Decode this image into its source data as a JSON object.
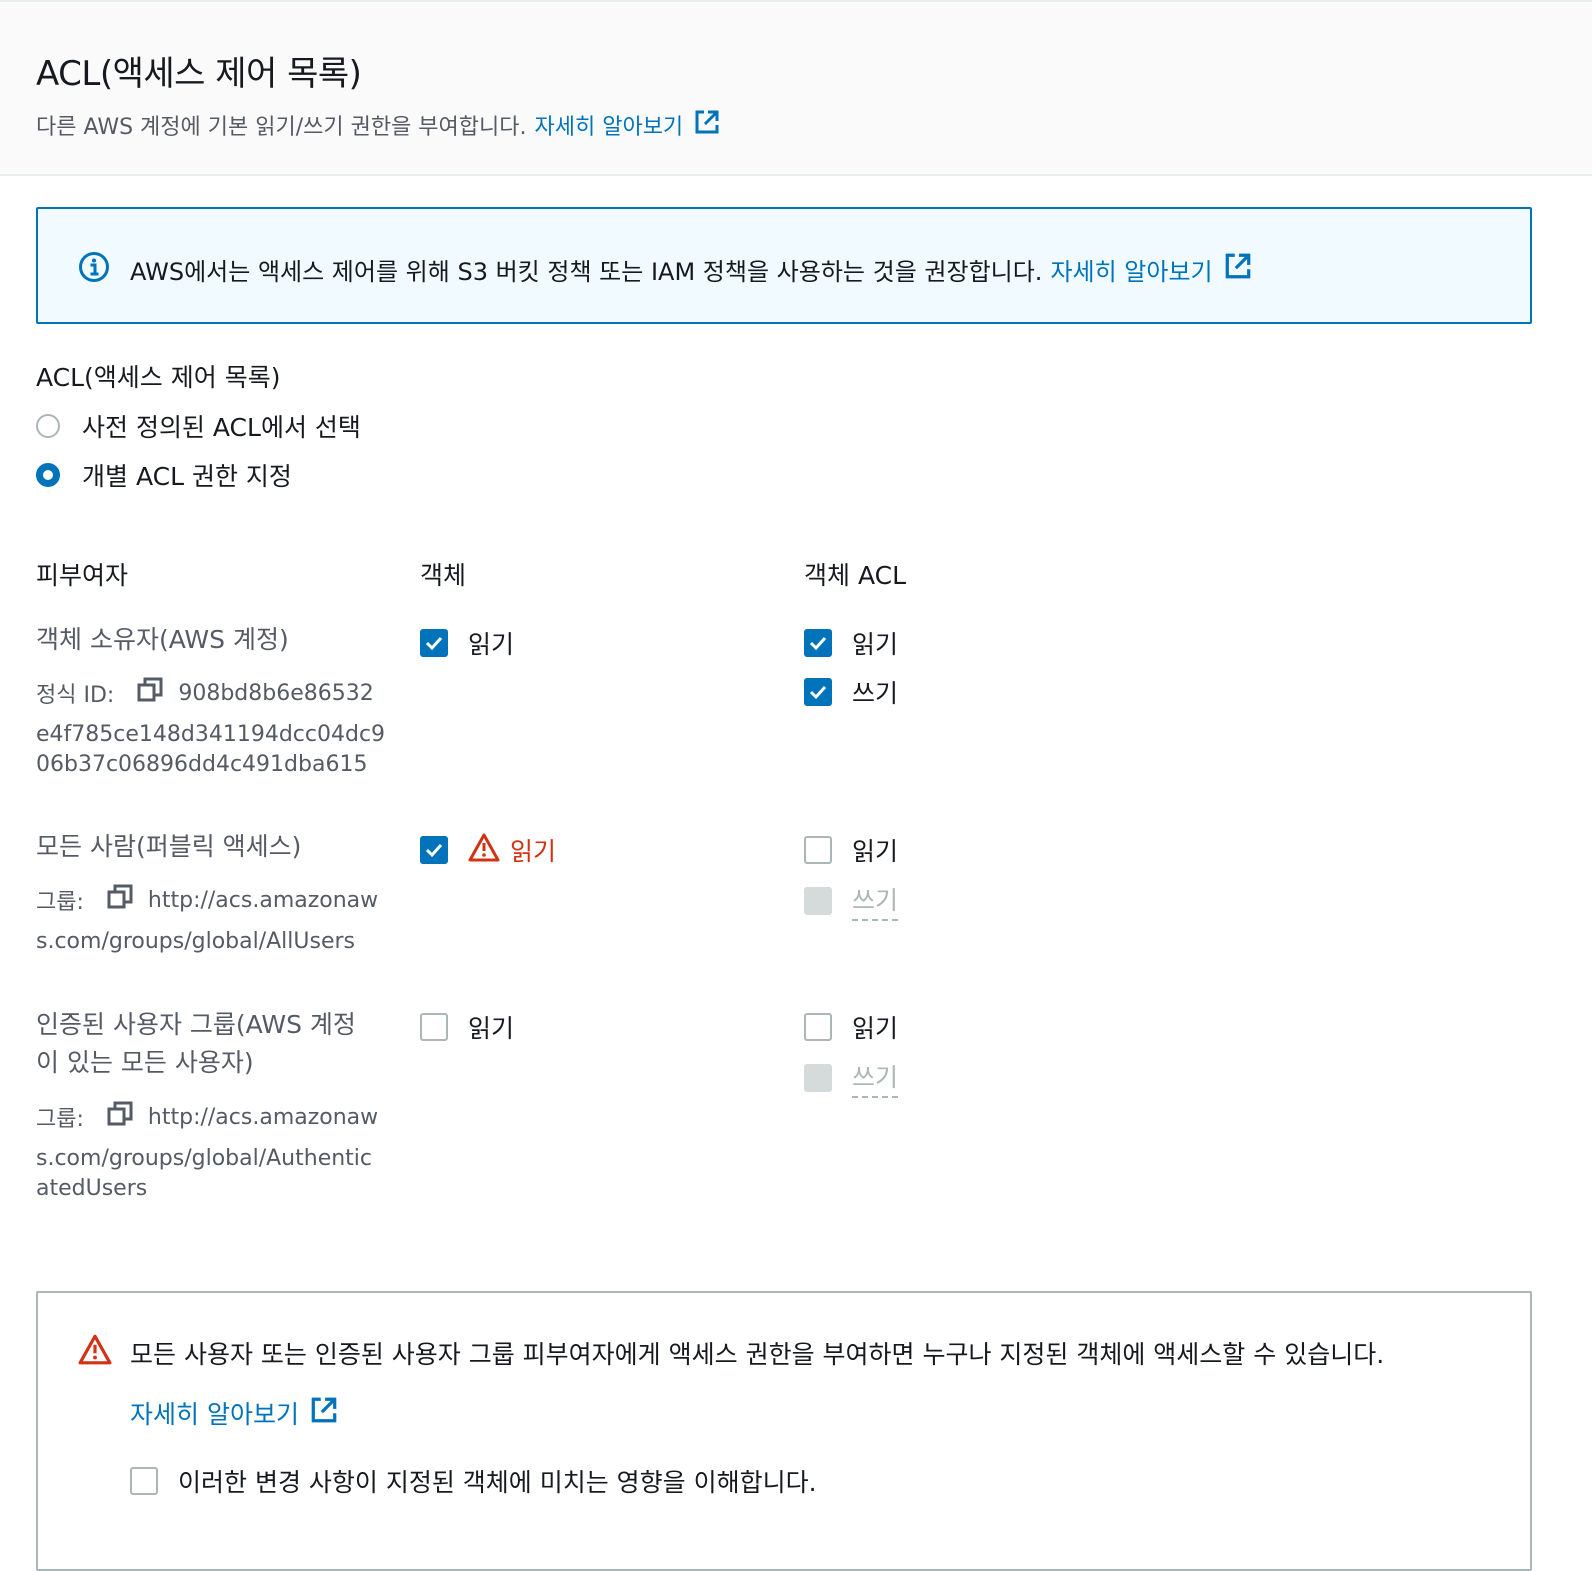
{
  "header": {
    "title": "ACL(액세스 제어 목록)",
    "description": "다른 AWS 계정에 기본 읽기/쓰기 권한을 부여합니다.",
    "learn_more": "자세히 알아보기"
  },
  "info_alert": {
    "text": "AWS에서는 액세스 제어를 위해 S3 버킷 정책 또는 IAM 정책을 사용하는 것을 권장합니다.",
    "learn_more": "자세히 알아보기"
  },
  "acl_section": {
    "label": "ACL(액세스 제어 목록)",
    "options": [
      {
        "label": "사전 정의된 ACL에서 선택",
        "selected": false
      },
      {
        "label": "개별 ACL 권한 지정",
        "selected": true
      }
    ]
  },
  "table": {
    "headers": {
      "grantee": "피부여자",
      "object": "객체",
      "object_acl": "객체 ACL"
    },
    "rows": [
      {
        "name": "객체 소유자(AWS 계정)",
        "id_label": "정식 ID:",
        "id_first": "908bd8b6e86532",
        "id_rest_1": "e4f785ce148d341194dcc04dc9",
        "id_rest_2": "06b37c06896dd4c491dba615",
        "object_read": {
          "label": "읽기",
          "checked": true
        },
        "acl_read": {
          "label": "읽기",
          "checked": true
        },
        "acl_write": {
          "label": "쓰기",
          "checked": true
        }
      },
      {
        "name": "모든 사람(퍼블릭 액세스)",
        "id_label": "그룹:",
        "id_first": "http://acs.amazonaw",
        "id_rest_1": "s.com/groups/global/AllUsers",
        "object_read": {
          "label": "읽기",
          "checked": true,
          "warning": true
        },
        "acl_read": {
          "label": "읽기",
          "checked": false
        },
        "acl_write": {
          "label": "쓰기",
          "checked": false,
          "disabled": true
        }
      },
      {
        "name_line1": "인증된 사용자 그룹(AWS 계정",
        "name_line2": "이 있는 모든 사용자)",
        "id_label": "그룹:",
        "id_first": "http://acs.amazonaw",
        "id_rest_1": "s.com/groups/global/Authentic",
        "id_rest_2": "atedUsers",
        "object_read": {
          "label": "읽기",
          "checked": false
        },
        "acl_read": {
          "label": "읽기",
          "checked": false
        },
        "acl_write": {
          "label": "쓰기",
          "checked": false,
          "disabled": true
        }
      }
    ]
  },
  "warning_alert": {
    "text": "모든 사용자 또는 인증된 사용자 그룹 피부여자에게 액세스 권한을 부여하면 누구나 지정된 객체에 액세스할 수 있습니다.",
    "learn_more": "자세히 알아보기",
    "acknowledge": "이러한 변경 사항이 지정된 객체에 미치는 영향을 이해합니다."
  },
  "colors": {
    "link": "#0073bb",
    "warning": "#d13212",
    "info_bg": "#f1faff"
  }
}
